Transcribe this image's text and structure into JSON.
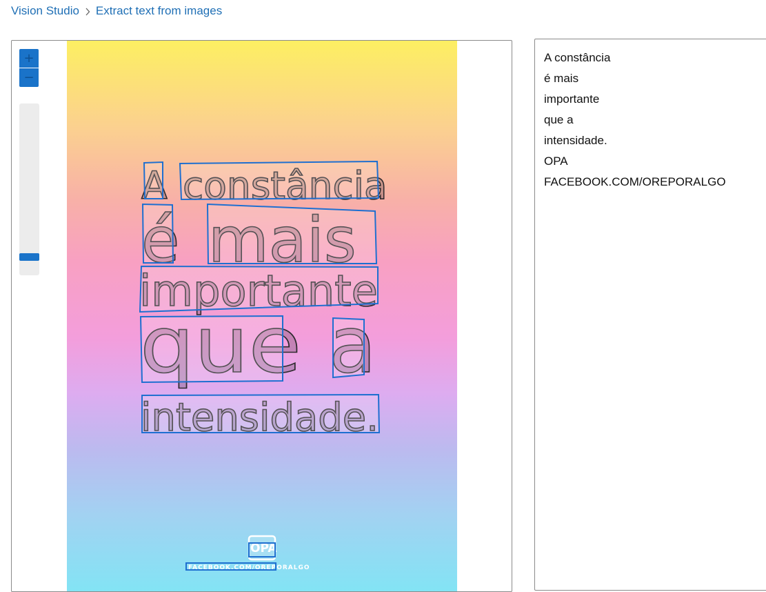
{
  "breadcrumb": {
    "root": "Vision Studio",
    "current": "Extract text from images"
  },
  "zoom": {
    "in_icon": "plus-icon",
    "out_icon": "minus-icon",
    "in_label": "+",
    "out_label": "−",
    "level": 0.03
  },
  "colors": {
    "accent": "#1a73c9",
    "link": "#1f6fb5",
    "box": "#1e6fd0"
  },
  "poster": {
    "words": [
      "A",
      "constância",
      "é",
      "mais",
      "importante",
      "que",
      "a",
      "intensidade."
    ],
    "badge": "OPA",
    "footer": "FACEBOOK.COM/OREPORALGO"
  },
  "results": {
    "lines": [
      "A constância",
      "é mais",
      "importante",
      "que a",
      "intensidade.",
      "OPA",
      "FACEBOOK.COM/OREPORALGO"
    ]
  }
}
